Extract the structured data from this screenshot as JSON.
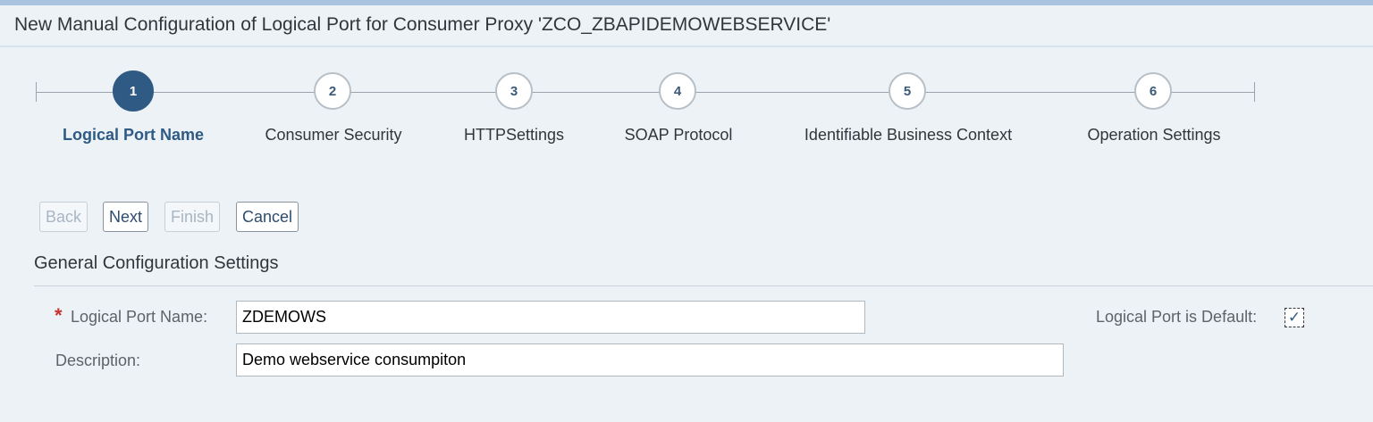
{
  "window": {
    "title": "New Manual Configuration of Logical Port for Consumer Proxy 'ZCO_ZBAPIDEMOWEBSERVICE'"
  },
  "wizard": {
    "steps": [
      {
        "number": "1",
        "label": "Logical Port Name",
        "active": true
      },
      {
        "number": "2",
        "label": "Consumer Security",
        "active": false
      },
      {
        "number": "3",
        "label": "HTTPSettings",
        "active": false
      },
      {
        "number": "4",
        "label": "SOAP Protocol",
        "active": false
      },
      {
        "number": "5",
        "label": "Identifiable Business Context",
        "active": false
      },
      {
        "number": "6",
        "label": "Operation Settings",
        "active": false
      }
    ]
  },
  "toolbar": {
    "back_label": "Back",
    "next_label": "Next",
    "finish_label": "Finish",
    "cancel_label": "Cancel"
  },
  "section": {
    "title": "General Configuration Settings"
  },
  "form": {
    "required_marker": "*",
    "logical_port_name_label": "Logical Port Name:",
    "logical_port_name_value": "ZDEMOWS",
    "description_label": "Description:",
    "description_value": "Demo webservice consumpiton",
    "default_label": "Logical Port is Default:",
    "default_checked": true,
    "check_glyph": "✓"
  },
  "colors": {
    "accent": "#2e5a84",
    "background": "#edf2f7",
    "required": "#c7342f"
  }
}
